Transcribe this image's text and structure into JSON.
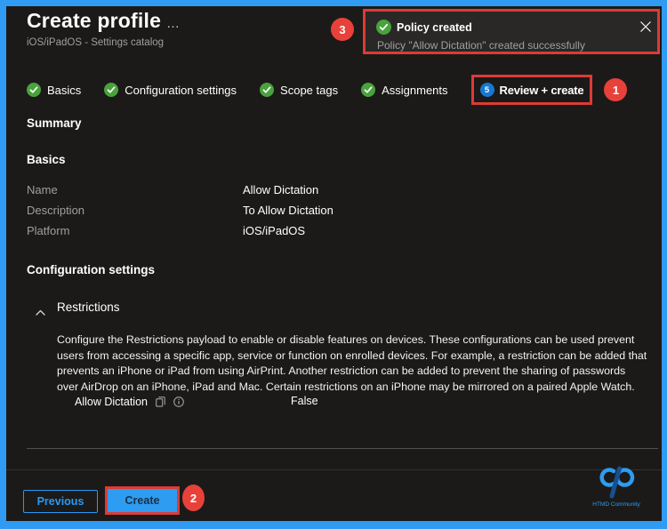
{
  "page": {
    "title": "Create profile",
    "subtitle": "iOS/iPadOS - Settings catalog",
    "more_label": "…"
  },
  "toast": {
    "title": "Policy created",
    "message": "Policy \"Allow Dictation\" created successfully"
  },
  "annotations": {
    "one": "1",
    "two": "2",
    "three": "3"
  },
  "wizard": {
    "steps": [
      {
        "label": "Basics",
        "state": "complete"
      },
      {
        "label": "Configuration settings",
        "state": "complete"
      },
      {
        "label": "Scope tags",
        "state": "complete"
      },
      {
        "label": "Assignments",
        "state": "complete"
      },
      {
        "label": "Review + create",
        "state": "current",
        "number": "5"
      }
    ]
  },
  "summary": {
    "heading": "Summary",
    "basics_heading": "Basics",
    "fields": [
      {
        "label": "Name",
        "value": "Allow Dictation"
      },
      {
        "label": "Description",
        "value": "To Allow Dictation"
      },
      {
        "label": "Platform",
        "value": "iOS/iPadOS"
      }
    ],
    "config_heading": "Configuration settings"
  },
  "restrictions": {
    "heading": "Restrictions",
    "description_lines": [
      "Configure the Restrictions payload to enable or disable features on devices. These configurations can be used prevent",
      "users from accessing a specific app, service or function on enrolled devices. For example, a restriction can be added that",
      "prevents an iPhone or iPad from using AirPrint. Another restriction can be added to prevent the sharing of passwords",
      "over AirDrop on an iPhone, iPad and Mac. Certain restrictions on an iPhone may be mirrored on a paired Apple Watch."
    ],
    "setting_label": "Allow Dictation",
    "setting_value": "False"
  },
  "footer": {
    "previous_label": "Previous",
    "create_label": "Create"
  },
  "branding": {
    "logo_text": "HTMD Community"
  },
  "colors": {
    "page_border": "#2f9bf2",
    "background": "#1b1a19",
    "annotation_red": "#e8413a",
    "highlight_red": "#dd3b35",
    "success_green": "#4aa23c",
    "accent_blue": "#2899f5"
  }
}
